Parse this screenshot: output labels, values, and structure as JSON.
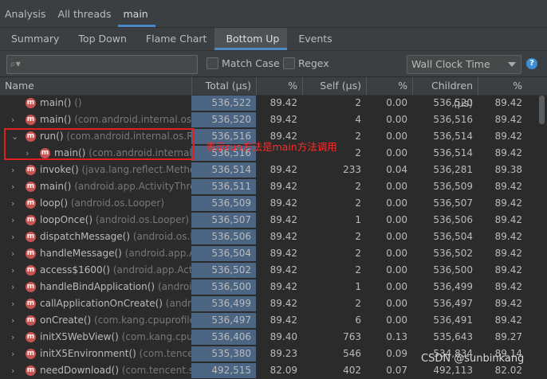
{
  "top_tabs": [
    "Analysis",
    "All threads",
    "main"
  ],
  "sub_tabs": [
    "Summary",
    "Top Down",
    "Flame Chart",
    "Bottom Up",
    "Events"
  ],
  "toolbar": {
    "search_placeholder": "",
    "match_case_label": "Match Case",
    "regex_label": "Regex",
    "clock_select": "Wall Clock Time",
    "help_icon": "?"
  },
  "columns": [
    "Name",
    "Total (µs)",
    "%",
    "Self (µs)",
    "%",
    "Children (µs)",
    "%"
  ],
  "rows": [
    {
      "method": "main()",
      "pkg": "()",
      "total": "536,522",
      "pct": "89.42",
      "self": "2",
      "spct": "0.00",
      "children": "536,520",
      "cpct": "89.42",
      "chev": "",
      "indent": 0
    },
    {
      "method": "main()",
      "pkg": "(com.android.internal.os.Z",
      "total": "536,520",
      "pct": "89.42",
      "self": "4",
      "spct": "0.00",
      "children": "536,516",
      "cpct": "89.42",
      "chev": "›",
      "indent": 0
    },
    {
      "method": "run()",
      "pkg": "(com.android.internal.os.Ru",
      "total": "536,516",
      "pct": "89.42",
      "self": "2",
      "spct": "0.00",
      "children": "536,514",
      "cpct": "89.42",
      "chev": "⌄",
      "indent": 0
    },
    {
      "method": "main()",
      "pkg": "(com.android.internal.c",
      "total": "536,516",
      "pct": "",
      "self": "2",
      "spct": "0.00",
      "children": "536,514",
      "cpct": "89.42",
      "chev": "›",
      "indent": 1
    },
    {
      "method": "invoke()",
      "pkg": "(java.lang.reflect.Method",
      "total": "536,514",
      "pct": "89.42",
      "self": "233",
      "spct": "0.04",
      "children": "536,281",
      "cpct": "89.38",
      "chev": "›",
      "indent": 0
    },
    {
      "method": "main()",
      "pkg": "(android.app.ActivityThrea",
      "total": "536,511",
      "pct": "89.42",
      "self": "2",
      "spct": "0.00",
      "children": "536,509",
      "cpct": "89.42",
      "chev": "›",
      "indent": 0
    },
    {
      "method": "loop()",
      "pkg": "(android.os.Looper)",
      "total": "536,509",
      "pct": "89.42",
      "self": "2",
      "spct": "0.00",
      "children": "536,507",
      "cpct": "89.42",
      "chev": "›",
      "indent": 0
    },
    {
      "method": "loopOnce()",
      "pkg": "(android.os.Looper)",
      "total": "536,507",
      "pct": "89.42",
      "self": "1",
      "spct": "0.00",
      "children": "536,506",
      "cpct": "89.42",
      "chev": "›",
      "indent": 0
    },
    {
      "method": "dispatchMessage()",
      "pkg": "(android.os.H",
      "total": "536,506",
      "pct": "89.42",
      "self": "2",
      "spct": "0.00",
      "children": "536,504",
      "cpct": "89.42",
      "chev": "›",
      "indent": 0
    },
    {
      "method": "handleMessage()",
      "pkg": "(android.app.A",
      "total": "536,504",
      "pct": "89.42",
      "self": "2",
      "spct": "0.00",
      "children": "536,502",
      "cpct": "89.42",
      "chev": "›",
      "indent": 0
    },
    {
      "method": "access$1600()",
      "pkg": "(android.app.Activ",
      "total": "536,502",
      "pct": "89.42",
      "self": "2",
      "spct": "0.00",
      "children": "536,500",
      "cpct": "89.42",
      "chev": "›",
      "indent": 0
    },
    {
      "method": "handleBindApplication()",
      "pkg": "(androi",
      "total": "536,500",
      "pct": "89.42",
      "self": "1",
      "spct": "0.00",
      "children": "536,499",
      "cpct": "89.42",
      "chev": "›",
      "indent": 0
    },
    {
      "method": "callApplicationOnCreate()",
      "pkg": "(andro",
      "total": "536,499",
      "pct": "89.42",
      "self": "2",
      "spct": "0.00",
      "children": "536,497",
      "cpct": "89.42",
      "chev": "›",
      "indent": 0
    },
    {
      "method": "onCreate()",
      "pkg": "(com.kang.cpuprofile",
      "total": "536,497",
      "pct": "89.42",
      "self": "6",
      "spct": "0.00",
      "children": "536,491",
      "cpct": "89.42",
      "chev": "›",
      "indent": 0
    },
    {
      "method": "initX5WebView()",
      "pkg": "(com.kang.cpu",
      "total": "536,406",
      "pct": "89.40",
      "self": "763",
      "spct": "0.13",
      "children": "535,643",
      "cpct": "89.27",
      "chev": "›",
      "indent": 0
    },
    {
      "method": "initX5Environment()",
      "pkg": "(com.tencent",
      "total": "535,380",
      "pct": "89.23",
      "self": "546",
      "spct": "0.09",
      "children": "534,834",
      "cpct": "89.14",
      "chev": "›",
      "indent": 0
    },
    {
      "method": "needDownload()",
      "pkg": "(com.tencent.sm",
      "total": "492,515",
      "pct": "82.09",
      "self": "402",
      "spct": "0.07",
      "children": "492,113",
      "cpct": "82.02",
      "chev": "›",
      "indent": 0
    }
  ],
  "annotation": "表示run方法是main方法调用",
  "watermark": "CSDN @sunbinkang",
  "colors": {
    "accent": "#4a88c7",
    "total_bar": "#4b6582",
    "method_icon": "#c75450",
    "annotation": "#e02020"
  }
}
